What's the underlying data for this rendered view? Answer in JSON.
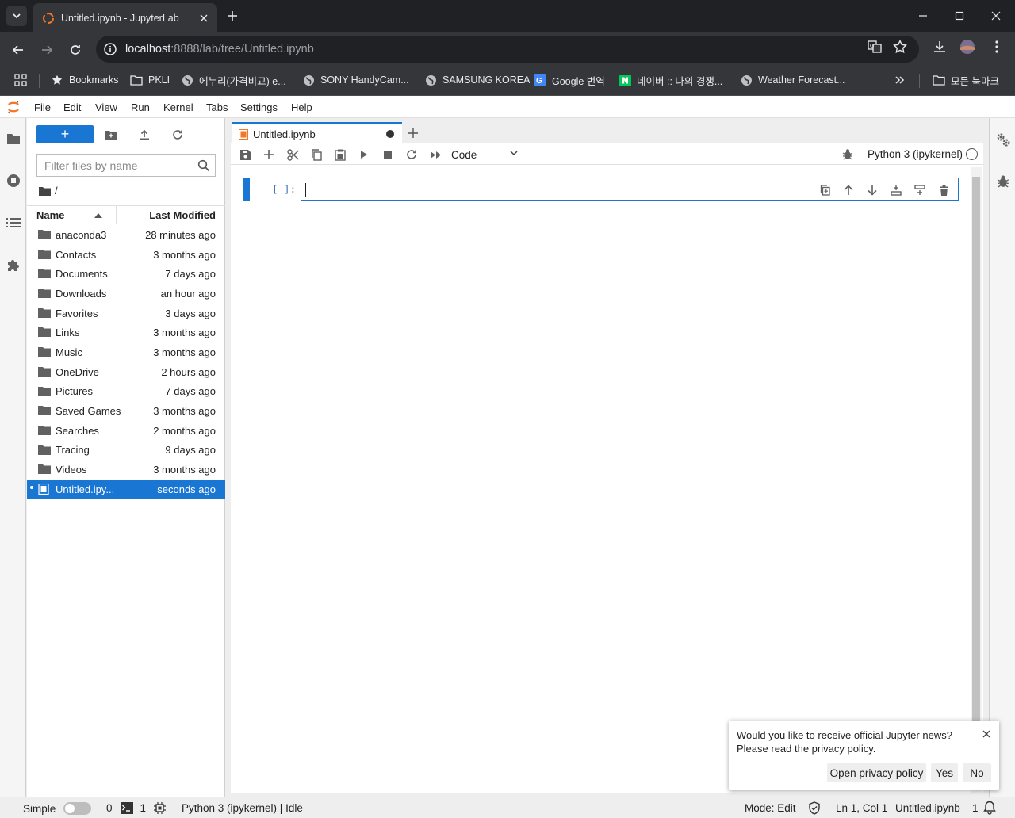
{
  "browser": {
    "tab_title": "Untitled.ipynb - JupyterLab",
    "url_host": "localhost",
    "url_rest": ":8888/lab/tree/Untitled.ipynb",
    "bookmarks": [
      {
        "label": "Bookmarks",
        "icon": "star-icon"
      },
      {
        "label": "PKLI",
        "icon": "folder-icon"
      },
      {
        "label": "에누리(가격비교) e...",
        "icon": "globe-icon"
      },
      {
        "label": "SONY HandyCam...",
        "icon": "globe-icon"
      },
      {
        "label": "SAMSUNG KOREA",
        "icon": "globe-icon"
      },
      {
        "label": "Google 번역",
        "icon": "google-translate-icon"
      },
      {
        "label": "네이버 :: 나의 경쟁...",
        "icon": "naver-icon"
      },
      {
        "label": "Weather Forecast...",
        "icon": "globe-icon"
      }
    ],
    "all_bookmarks": "모든 북마크"
  },
  "menu": [
    "File",
    "Edit",
    "View",
    "Run",
    "Kernel",
    "Tabs",
    "Settings",
    "Help"
  ],
  "filebrowser": {
    "new_label": "+",
    "filter_placeholder": "Filter files by name",
    "breadcrumb": "/",
    "col_name": "Name",
    "col_modified": "Last Modified",
    "items": [
      {
        "name": "anaconda3",
        "modified": "28 minutes ago",
        "type": "folder"
      },
      {
        "name": "Contacts",
        "modified": "3 months ago",
        "type": "folder"
      },
      {
        "name": "Documents",
        "modified": "7 days ago",
        "type": "folder"
      },
      {
        "name": "Downloads",
        "modified": "an hour ago",
        "type": "folder"
      },
      {
        "name": "Favorites",
        "modified": "3 days ago",
        "type": "folder"
      },
      {
        "name": "Links",
        "modified": "3 months ago",
        "type": "folder"
      },
      {
        "name": "Music",
        "modified": "3 months ago",
        "type": "folder"
      },
      {
        "name": "OneDrive",
        "modified": "2 hours ago",
        "type": "folder"
      },
      {
        "name": "Pictures",
        "modified": "7 days ago",
        "type": "folder"
      },
      {
        "name": "Saved Games",
        "modified": "3 months ago",
        "type": "folder"
      },
      {
        "name": "Searches",
        "modified": "2 months ago",
        "type": "folder"
      },
      {
        "name": "Tracing",
        "modified": "9 days ago",
        "type": "folder"
      },
      {
        "name": "Videos",
        "modified": "3 months ago",
        "type": "folder"
      },
      {
        "name": "Untitled.ipy...",
        "modified": "seconds ago",
        "type": "notebook",
        "selected": true
      }
    ]
  },
  "notebook": {
    "tab_name": "Untitled.ipynb",
    "cell_type": "Code",
    "kernel": "Python 3 (ipykernel)",
    "cell_prompt": "[ ]:"
  },
  "notification": {
    "message_line1": "Would you like to receive official Jupyter news?",
    "message_line2": "Please read the privacy policy.",
    "privacy_button": "Open privacy policy",
    "yes_button": "Yes",
    "no_button": "No"
  },
  "statusbar": {
    "mode_label": "Simple",
    "terminals_count": "0",
    "kernels_count": "1",
    "kernel_status": "Python 3 (ipykernel) | Idle",
    "mode": "Mode: Edit",
    "cursor": "Ln 1, Col 1",
    "filename": "Untitled.ipynb",
    "notifications_count": "1"
  },
  "colors": {
    "accent": "#1976d2",
    "jupyter_orange": "#f37726"
  }
}
